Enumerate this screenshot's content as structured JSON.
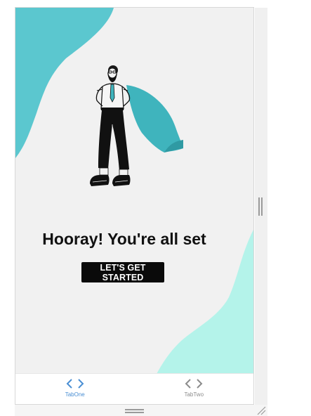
{
  "app": {
    "headline": "Hooray! You're all set",
    "cta_label": "LET'S GET STARTED"
  },
  "tabs": [
    {
      "label": "TabOne",
      "icon": "code-icon",
      "active": true
    },
    {
      "label": "TabTwo",
      "icon": "code-icon",
      "active": false
    }
  ],
  "colors": {
    "accent_teal": "#5bc7cf",
    "accent_mint": "#b4f3ea",
    "tab_active": "#4a8fd4",
    "tab_inactive": "#8c8c8c",
    "button_bg": "#0a0a0a"
  }
}
